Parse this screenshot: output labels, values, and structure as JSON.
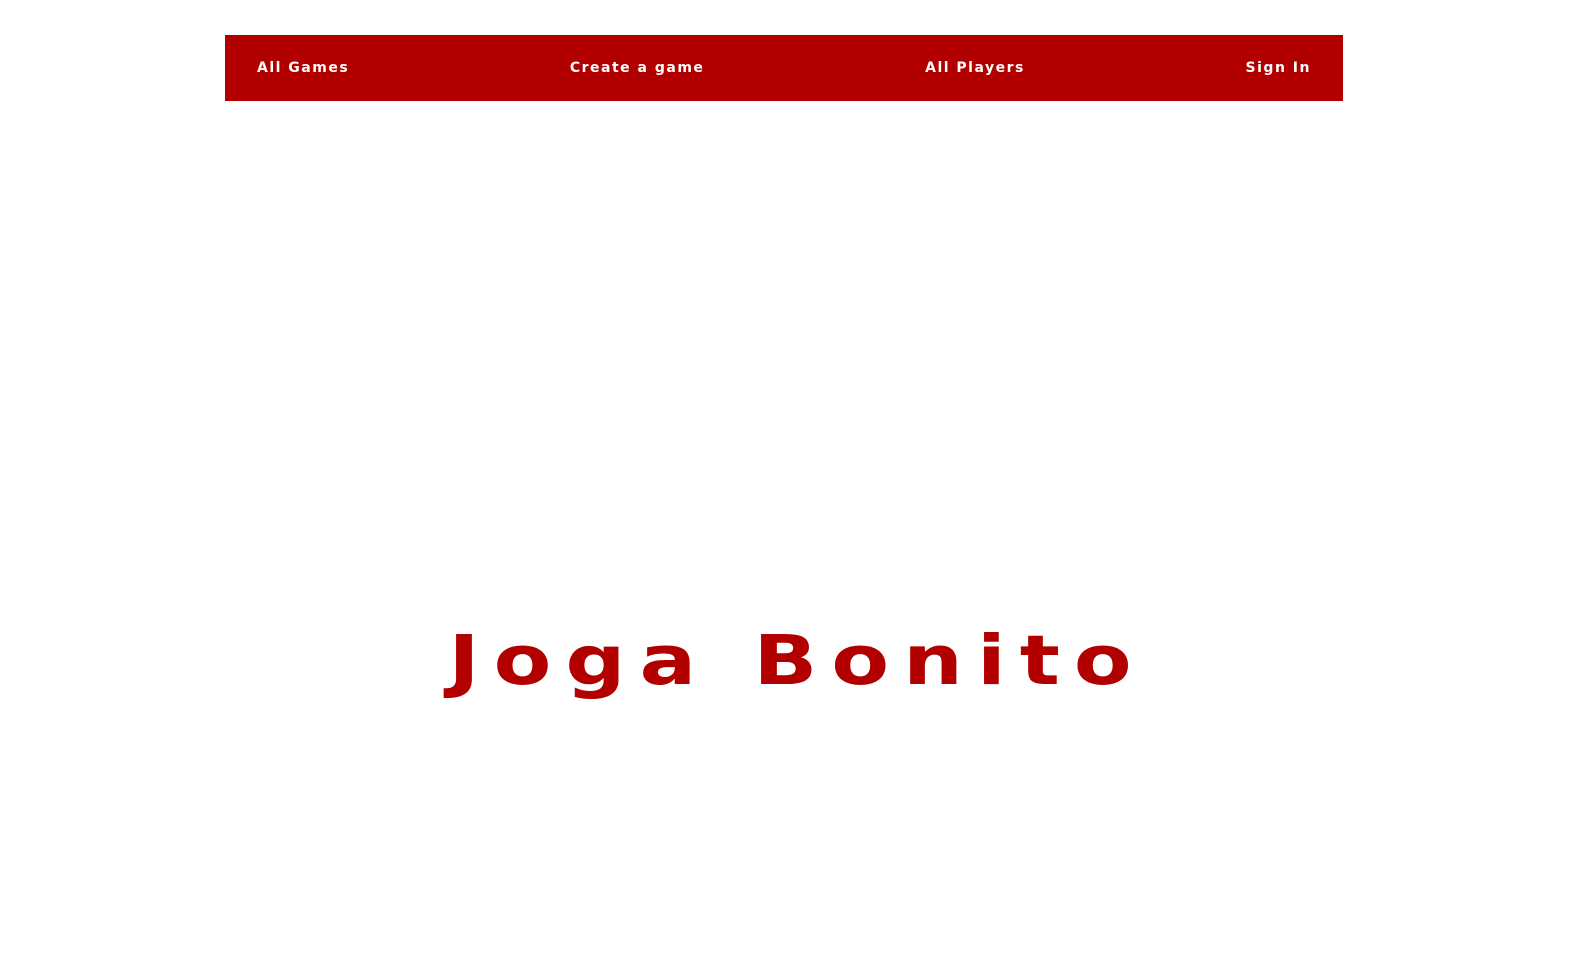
{
  "theme": {
    "accent": "#b20000",
    "nav_text": "#ffffff",
    "background": "#ffffff"
  },
  "nav": {
    "items": [
      {
        "label": "All Games"
      },
      {
        "label": "Create a game"
      },
      {
        "label": "All Players"
      },
      {
        "label": "Sign In"
      }
    ]
  },
  "hero": {
    "title": "Joga Bonito"
  }
}
